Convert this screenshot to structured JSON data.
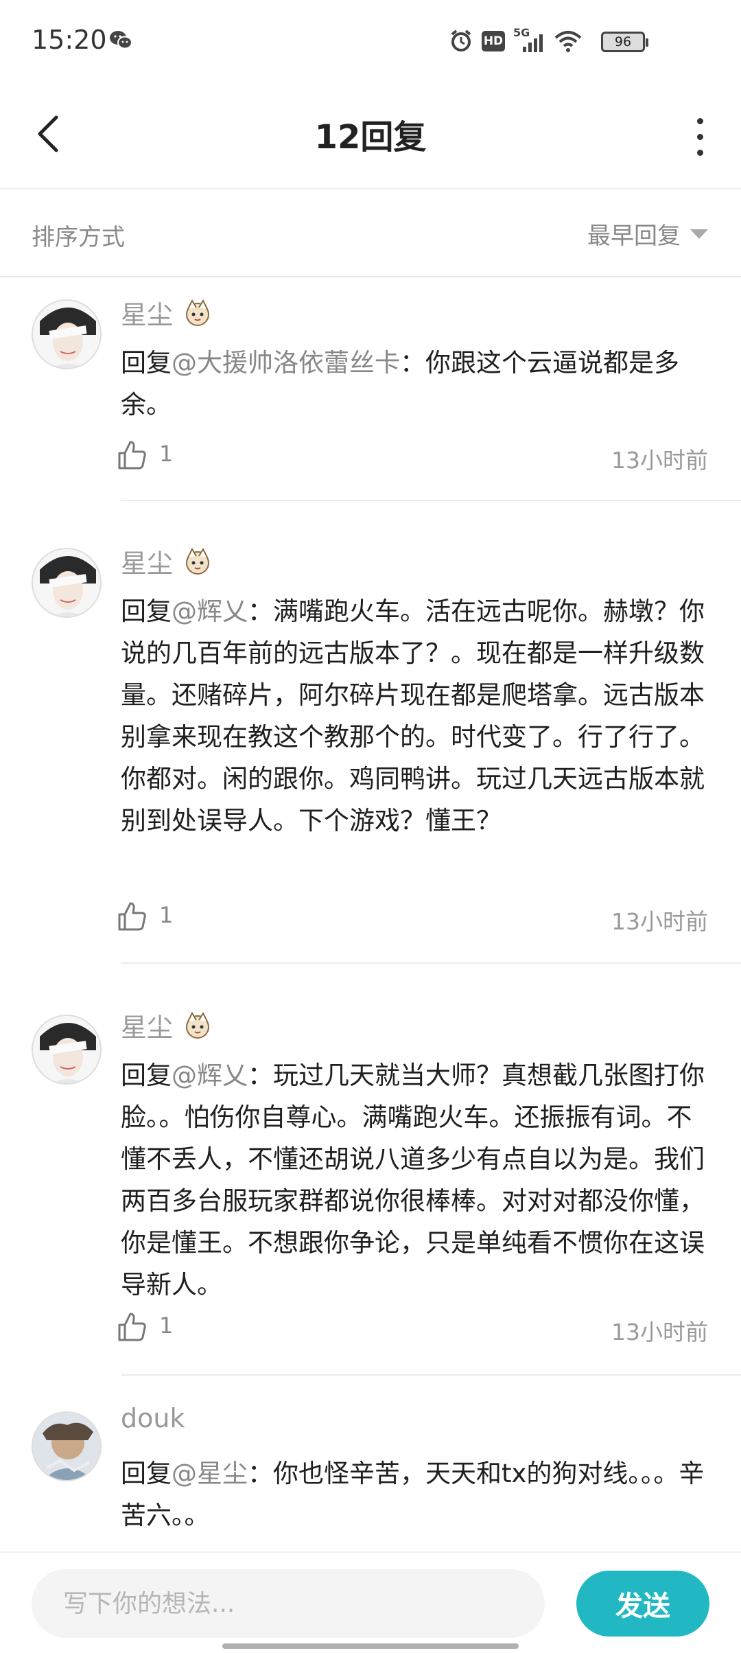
{
  "status_bar": {
    "time": "15:20",
    "battery": "96",
    "network": "5G",
    "hd": "HD"
  },
  "nav": {
    "title": "12回复"
  },
  "sort": {
    "label": "排序方式",
    "selected": "最早回复"
  },
  "comments": [
    {
      "user": "星尘",
      "prefix": "回复",
      "mention": "@大援帅洛依蕾丝卡",
      "text": "：你跟这个云逼说都是多余。",
      "likes": "1",
      "time": "13小时前"
    },
    {
      "user": "星尘",
      "prefix": "回复",
      "mention": "@辉乂",
      "text": "：满嘴跑火车。活在远古呢你。赫墩？你说的几百年前的远古版本了？。现在都是一样升级数量。还赌碎片，阿尔碎片现在都是爬塔拿。远古版本别拿来现在教这个教那个的。时代变了。行了行了。你都对。闲的跟你。鸡同鸭讲。玩过几天远古版本就别到处误导人。下个游戏？懂王？",
      "likes": "1",
      "time": "13小时前"
    },
    {
      "user": "星尘",
      "prefix": "回复",
      "mention": "@辉乂",
      "text": "：玩过几天就当大师？真想截几张图打你脸。。怕伤你自尊心。满嘴跑火车。还振振有词。不懂不丢人，不懂还胡说八道多少有点自以为是。我们两百多台服玩家群都说你很棒棒。对对对都没你懂，你是懂王。不想跟你争论，只是单纯看不惯你在这误导新人。",
      "likes": "1",
      "time": "13小时前"
    },
    {
      "user": "douk",
      "prefix": "回复",
      "mention": "@星尘",
      "text": "：你也怪辛苦，天天和tx的狗对线。。。辛苦六。。",
      "likes": "",
      "time": ""
    }
  ],
  "composer": {
    "placeholder": "写下你的想法...",
    "send_label": "发送"
  },
  "colors": {
    "accent": "#21b8c3",
    "muted_text": "#999999",
    "body_text": "#1f1f1f"
  },
  "icons": [
    "back-arrow-icon",
    "more-vertical-icon",
    "dropdown-triangle-icon",
    "thumbs-up-icon",
    "wechat-icon",
    "alarm-icon",
    "wifi-icon",
    "signal-icon",
    "battery-icon"
  ]
}
